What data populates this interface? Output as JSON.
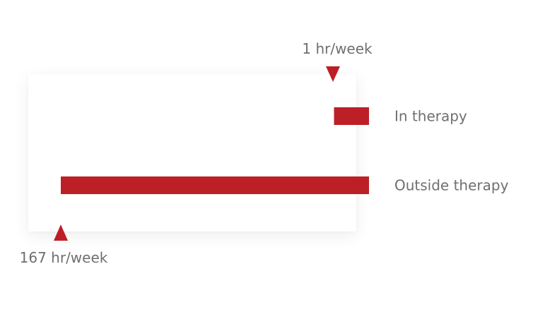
{
  "chart_data": {
    "type": "bar",
    "orientation": "horizontal",
    "categories": [
      "In therapy",
      "Outside therapy"
    ],
    "values": [
      1,
      167
    ],
    "unit": "hr/week",
    "annotations": [
      "1 hr/week",
      "167 hr/week"
    ],
    "xlim": [
      0,
      168
    ],
    "grid": false,
    "legend": "none",
    "bar_color": "#bd1f27"
  }
}
